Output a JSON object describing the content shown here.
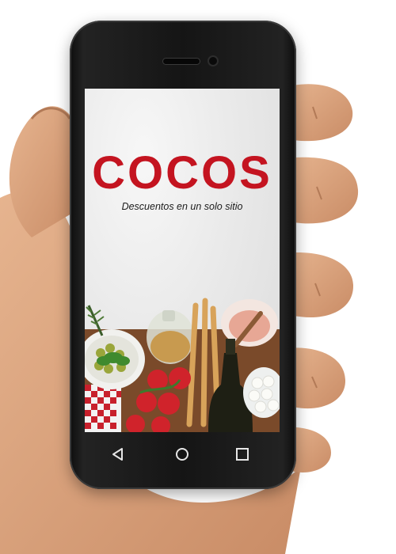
{
  "app": {
    "brand": "COCOS",
    "tagline": "Descuentos en un solo sitio"
  },
  "navbar": {
    "back_icon": "back-triangle-icon",
    "home_icon": "home-circle-icon",
    "recents_icon": "recents-square-icon"
  },
  "colors": {
    "brand_red": "#c41420",
    "tagline_text": "#1c1c1c"
  }
}
